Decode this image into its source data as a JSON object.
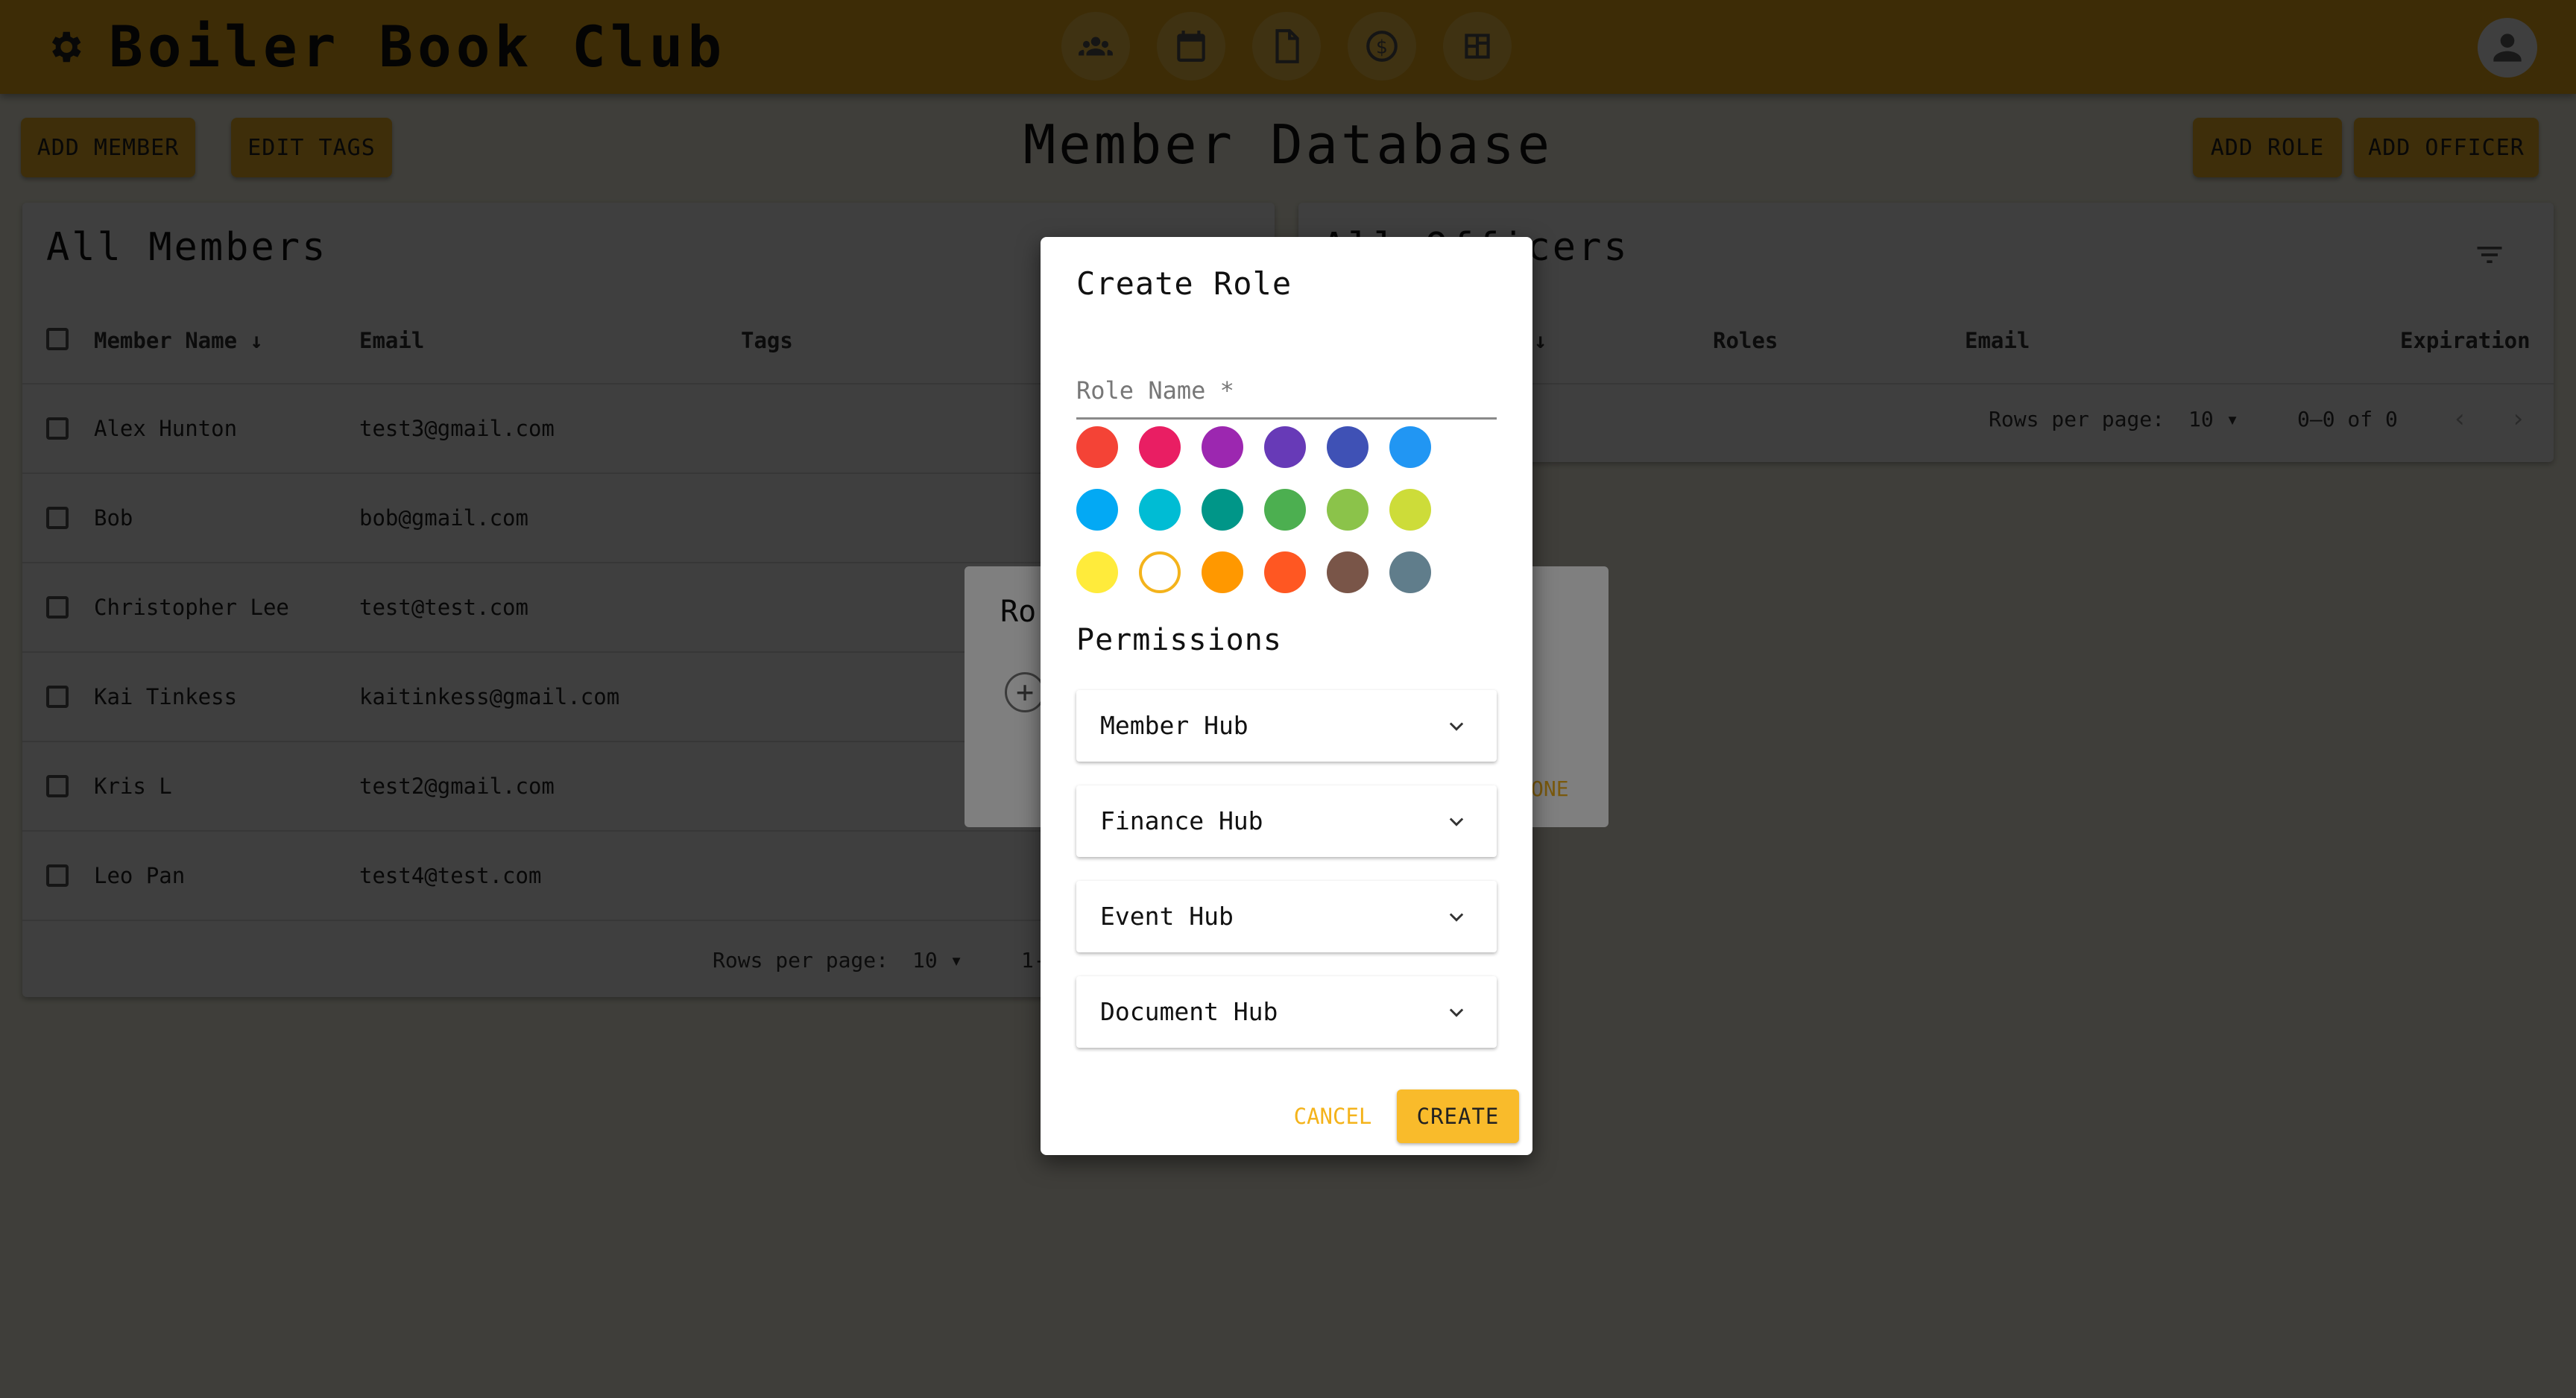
{
  "app": {
    "title": "Boiler Book Club"
  },
  "nav": [
    "members-icon",
    "calendar-icon",
    "document-icon",
    "dollar-icon",
    "dashboard-icon"
  ],
  "toolbar": {
    "add_member": "ADD MEMBER",
    "edit_tags": "EDIT TAGS",
    "page_title": "Member Database",
    "add_role": "ADD ROLE",
    "add_officer": "ADD OFFICER"
  },
  "members": {
    "title": "All Members",
    "columns": [
      "Member Name",
      "Email",
      "Tags"
    ],
    "rows": [
      {
        "name": "Alex Hunton",
        "email": "test3@gmail.com"
      },
      {
        "name": "Bob",
        "email": "bob@gmail.com"
      },
      {
        "name": "Christopher Lee",
        "email": "test@test.com"
      },
      {
        "name": "Kai Tinkess",
        "email": "kaitinkess@gmail.com"
      },
      {
        "name": "Kris L",
        "email": "test2@gmail.com"
      },
      {
        "name": "Leo Pan",
        "email": "test4@test.com"
      }
    ],
    "rows_per_page_label": "Rows per page:",
    "rows_per_page": "10",
    "range": "1-"
  },
  "officers": {
    "title": "All Officers",
    "columns": [
      "Roles",
      "Email",
      "Expiration"
    ],
    "rows_per_page_label": "Rows per page:",
    "rows_per_page": "10",
    "range": "0–0 of 0"
  },
  "back_dialog": {
    "title_fragment": "Ro",
    "action_fragment": "ONE"
  },
  "dialog": {
    "title": "Create Role",
    "role_name_placeholder": "Role Name *",
    "colors": [
      "#f44336",
      "#e91e63",
      "#9c27b0",
      "#673ab7",
      "#3f51b5",
      "#2196f3",
      "#03a9f4",
      "#00bcd4",
      "#009688",
      "#4caf50",
      "#8bc34a",
      "#cddc39",
      "#ffeb3b",
      "#ffffff",
      "#ff9800",
      "#ff5722",
      "#795548",
      "#607d8b"
    ],
    "selected_color": "#ffffff",
    "permissions_title": "Permissions",
    "permissions": [
      "Member Hub",
      "Finance Hub",
      "Event Hub",
      "Document Hub"
    ],
    "cancel_label": "CANCEL",
    "create_label": "CREATE"
  },
  "theme": {
    "accent": "#f4b31b",
    "button": "#f9bb2b"
  }
}
